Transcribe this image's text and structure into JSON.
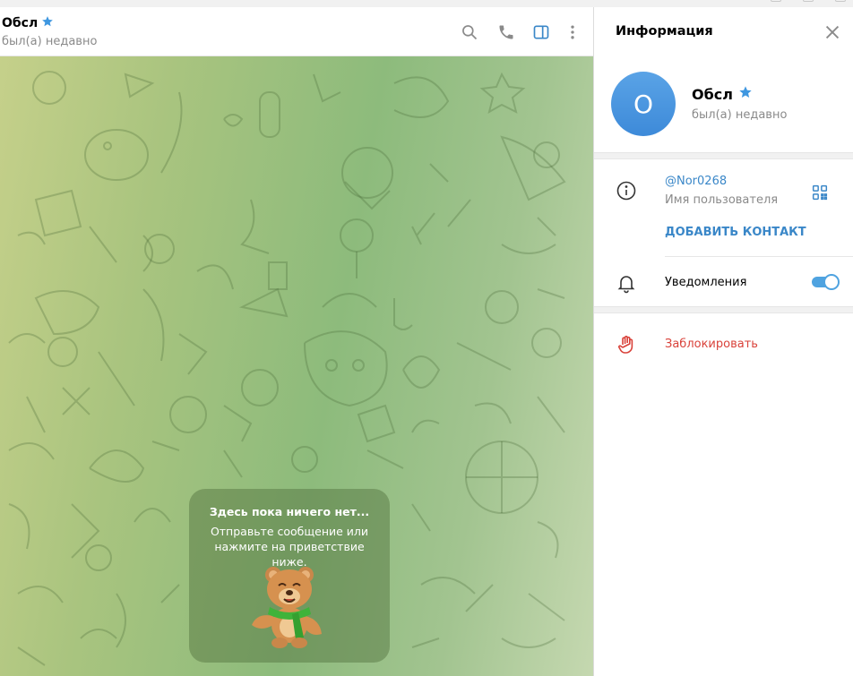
{
  "chat": {
    "title": "Обсл",
    "status": "был(а) недавно",
    "header_icons": [
      "search-icon",
      "phone-icon",
      "sidebar-toggle-icon",
      "more-vertical-icon"
    ],
    "empty_state": {
      "title": "Здесь пока ничего нет...",
      "text": "Отправьте сообщение или нажмите на приветствие ниже.",
      "sticker": "bear-greeting-sticker"
    }
  },
  "info_panel": {
    "title": "Информация",
    "profile": {
      "avatar_letter": "O",
      "name": "Обсл",
      "status": "был(а) недавно"
    },
    "username": "@Nor0268",
    "username_caption": "Имя пользователя",
    "add_contact": "ДОБАВИТЬ КОНТАКТ",
    "notifications_label": "Уведомления",
    "notifications_enabled": true,
    "block_label": "Заблокировать"
  },
  "colors": {
    "accent": "#3a87c8",
    "avatar": "#4a94dd",
    "danger": "#d9423a",
    "star": "#3f97e0"
  }
}
